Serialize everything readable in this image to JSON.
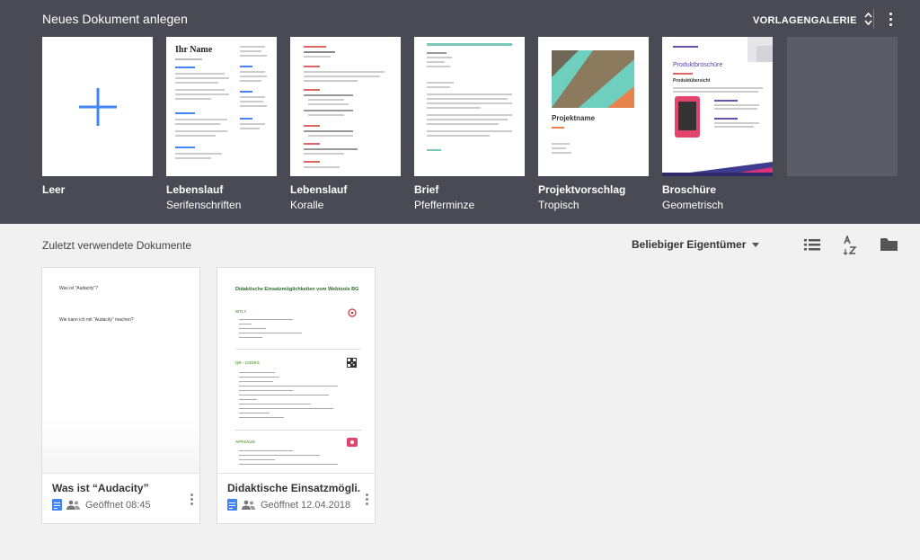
{
  "header": {
    "title": "Neues Dokument anlegen",
    "gallery_label": "VORLAGENGALERIE"
  },
  "templates": [
    {
      "name": "Leer",
      "sub": ""
    },
    {
      "name": "Lebenslauf",
      "sub": "Serifenschriften",
      "thumb_heading": "Ihr Name"
    },
    {
      "name": "Lebenslauf",
      "sub": "Koralle"
    },
    {
      "name": "Brief",
      "sub": "Pfefferminze"
    },
    {
      "name": "Projektvorschlag",
      "sub": "Tropisch",
      "thumb_heading": "Projektname"
    },
    {
      "name": "Broschüre",
      "sub": "Geometrisch",
      "thumb_heading": "Produktbroschüre",
      "thumb_sub": "Produktübersicht"
    }
  ],
  "recent": {
    "title": "Zuletzt verwendete Dokumente",
    "owner_filter": "Beliebiger Eigentümer",
    "docs": [
      {
        "title": "Was ist “Audacity”",
        "opened": "Geöffnet 08:45",
        "preview_title": "Was ist “Audacity”?",
        "preview_line": "Wie kann ich mit “Audacity” machen?"
      },
      {
        "title": "Didaktische Einsatzmögli...",
        "opened": "Geöffnet 12.04.2018",
        "preview_title": "Didaktische Einsatzmöglichkeiten vom Webtools BG",
        "preview_sections": [
          "WTLY",
          "QR - CODES",
          "APPZAUN"
        ]
      }
    ]
  },
  "colors": {
    "header_bg": "#4a4a54",
    "accent_blue": "#4285f4",
    "page_bg": "#f1f1f1"
  },
  "icons": [
    "plus-icon",
    "unfold-icon",
    "more-vert-icon",
    "list-view-icon",
    "sort-az-icon",
    "folder-icon",
    "doc-icon",
    "shared-people-icon"
  ]
}
